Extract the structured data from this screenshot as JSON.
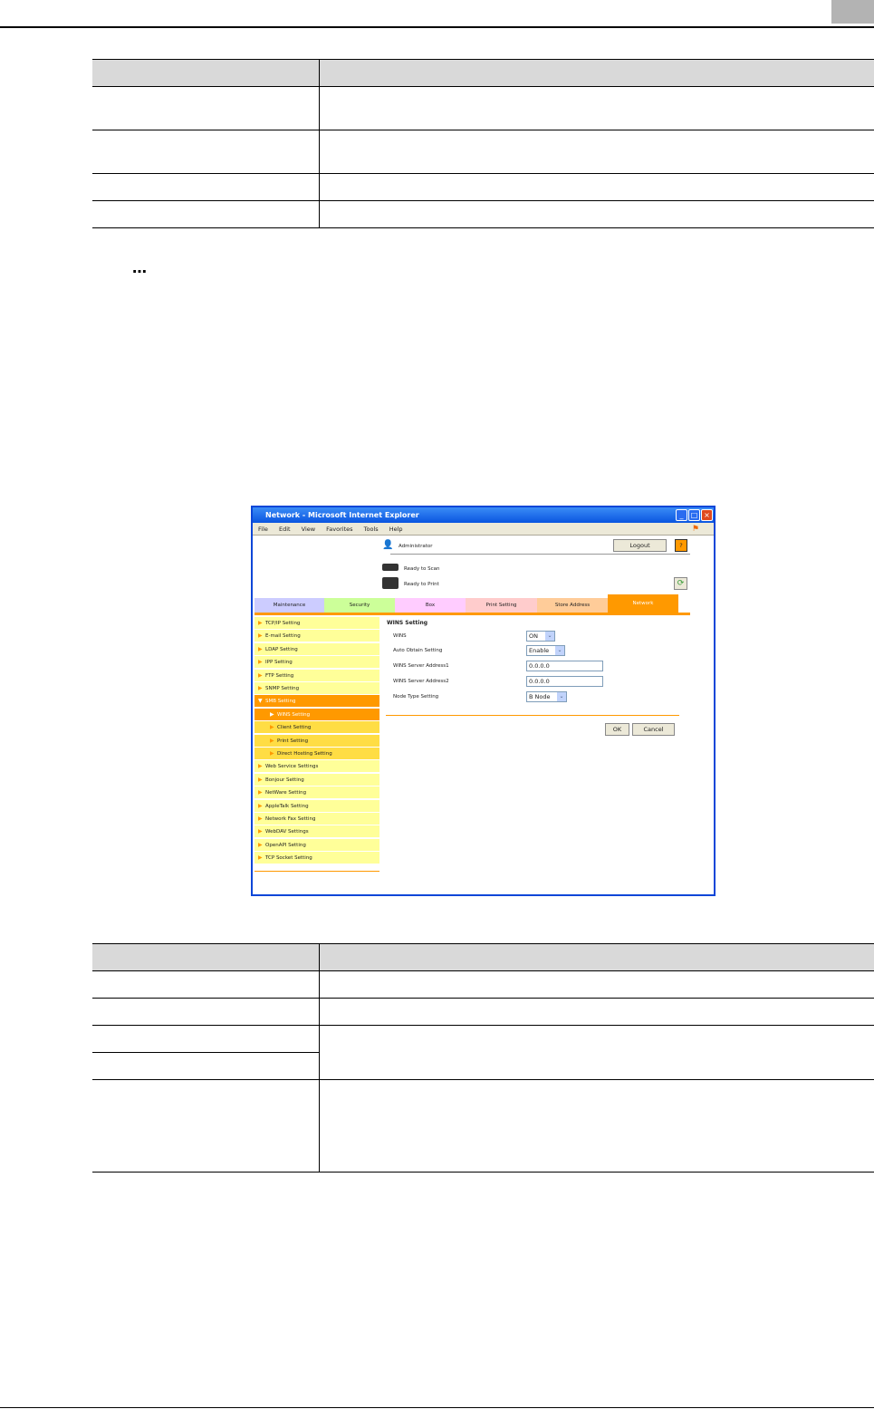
{
  "page": {
    "ellipsis": "…"
  },
  "browser": {
    "title": "Network - Microsoft Internet Explorer",
    "menu": [
      "File",
      "Edit",
      "View",
      "Favorites",
      "Tools",
      "Help"
    ],
    "user": "Administrator",
    "logout": "Logout",
    "help": "?",
    "status": [
      "Ready to Scan",
      "Ready to Print"
    ],
    "tabs": [
      {
        "label": "Maintenance",
        "color": "#ccccff"
      },
      {
        "label": "Security",
        "color": "#ccff99"
      },
      {
        "label": "Box",
        "color": "#ffccff"
      },
      {
        "label": "Print Setting",
        "color": "#ffcccc"
      },
      {
        "label": "Store Address",
        "color": "#ffcc99"
      },
      {
        "label": "Network",
        "color": "#ff9900"
      }
    ],
    "sidebar": [
      "TCP/IP Setting",
      "E-mail Setting",
      "LDAP Setting",
      "IPP Setting",
      "FTP Setting",
      "SNMP Setting",
      "SMB Setting",
      "WINS Setting",
      "Client Setting",
      "Print Setting",
      "Direct Hosting Setting",
      "Web Service Settings",
      "Bonjour Setting",
      "NetWare Setting",
      "AppleTalk Setting",
      "Network Fax Setting",
      "WebDAV Settings",
      "OpenAPI Setting",
      "TCP Socket Setting"
    ],
    "form": {
      "title": "WINS Setting",
      "labels": [
        "WINS",
        "Auto Obtain Setting",
        "WINS Server Address1",
        "WINS Server Address2",
        "Node Type Setting"
      ],
      "values": [
        "ON",
        "Enable",
        "0.0.0.0",
        "0.0.0.0",
        "B Node"
      ],
      "ok": "OK",
      "cancel": "Cancel"
    }
  }
}
